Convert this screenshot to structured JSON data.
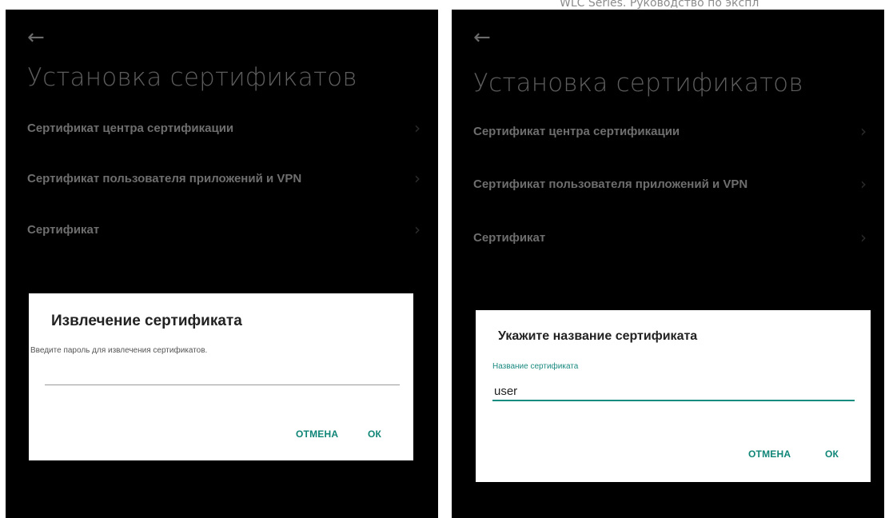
{
  "doc_header": "WLC Series. Руководство по экспл",
  "back_glyph": "←",
  "chevron_glyph": "›",
  "panels": [
    {
      "title": "Установка сертификатов",
      "menu": [
        {
          "label": "Сертификат центра сертификации"
        },
        {
          "label": "Сертификат пользователя приложений и VPN"
        },
        {
          "label": "Сертификат"
        }
      ],
      "dialog": {
        "title": "Извлечение сертификата",
        "message": "Введите пароль для извлечения сертификатов.",
        "input_value": "",
        "cancel_label": "ОТМЕНА",
        "ok_label": "ОК"
      }
    },
    {
      "title": "Установка сертификатов",
      "menu": [
        {
          "label": "Сертификат центра сертификации"
        },
        {
          "label": "Сертификат пользователя приложений и VPN"
        },
        {
          "label": "Сертификат"
        }
      ],
      "dialog": {
        "title": "Укажите название сертификата",
        "field_label": "Название сертификата",
        "input_value": "user",
        "cancel_label": "ОТМЕНА",
        "ok_label": "ОК"
      }
    }
  ],
  "colors": {
    "accent": "#128c7e",
    "background": "#000000",
    "dialog_bg": "#ffffff"
  }
}
